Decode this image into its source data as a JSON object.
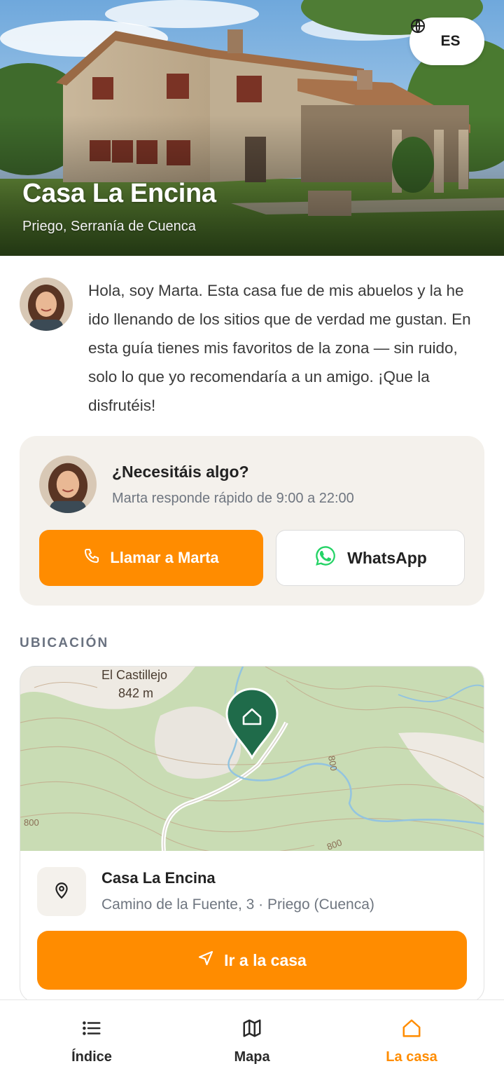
{
  "hero": {
    "title": "Casa La Encina",
    "subtitle": "Priego, Serranía de Cuenca",
    "lang_code": "ES",
    "lang_icon": "globe-icon"
  },
  "intro": {
    "text": "Hola, soy Marta. Esta casa fue de mis abuelos y la he ido llenando de los sitios que de verdad me gustan. En esta guía tienes mis favoritos de la zona — sin ruido, solo lo que yo recomendaría a un amigo. ¡Que la disfrutéis!"
  },
  "contact": {
    "title": "¿Necesitáis algo?",
    "subtitle": "Marta responde rápido de 9:00 a 22:00",
    "call_label": "Llamar a Marta",
    "call_icon": "phone-icon",
    "whatsapp_label": "WhatsApp",
    "whatsapp_icon": "whatsapp-icon"
  },
  "location": {
    "section_label": "UBICACIÓN",
    "map_place": "El Castillejo",
    "map_elevation": "842 m",
    "map_contour_a": "800",
    "map_contour_b": "800",
    "map_contour_c": "800",
    "name": "Casa La Encina",
    "address": "Camino de la Fuente, 3 · Priego (Cuenca)",
    "go_label": "Ir a la casa",
    "go_icon": "navigation-arrow-icon"
  },
  "nav": {
    "items": [
      {
        "label": "Índice",
        "icon": "list-icon",
        "active": false
      },
      {
        "label": "Mapa",
        "icon": "map-icon",
        "active": false
      },
      {
        "label": "La casa",
        "icon": "home-icon",
        "active": true
      }
    ]
  },
  "colors": {
    "accent": "#ff8c00",
    "pin": "#1f6b4a",
    "card_bg": "#f4f1ec",
    "muted": "#6f7680"
  }
}
